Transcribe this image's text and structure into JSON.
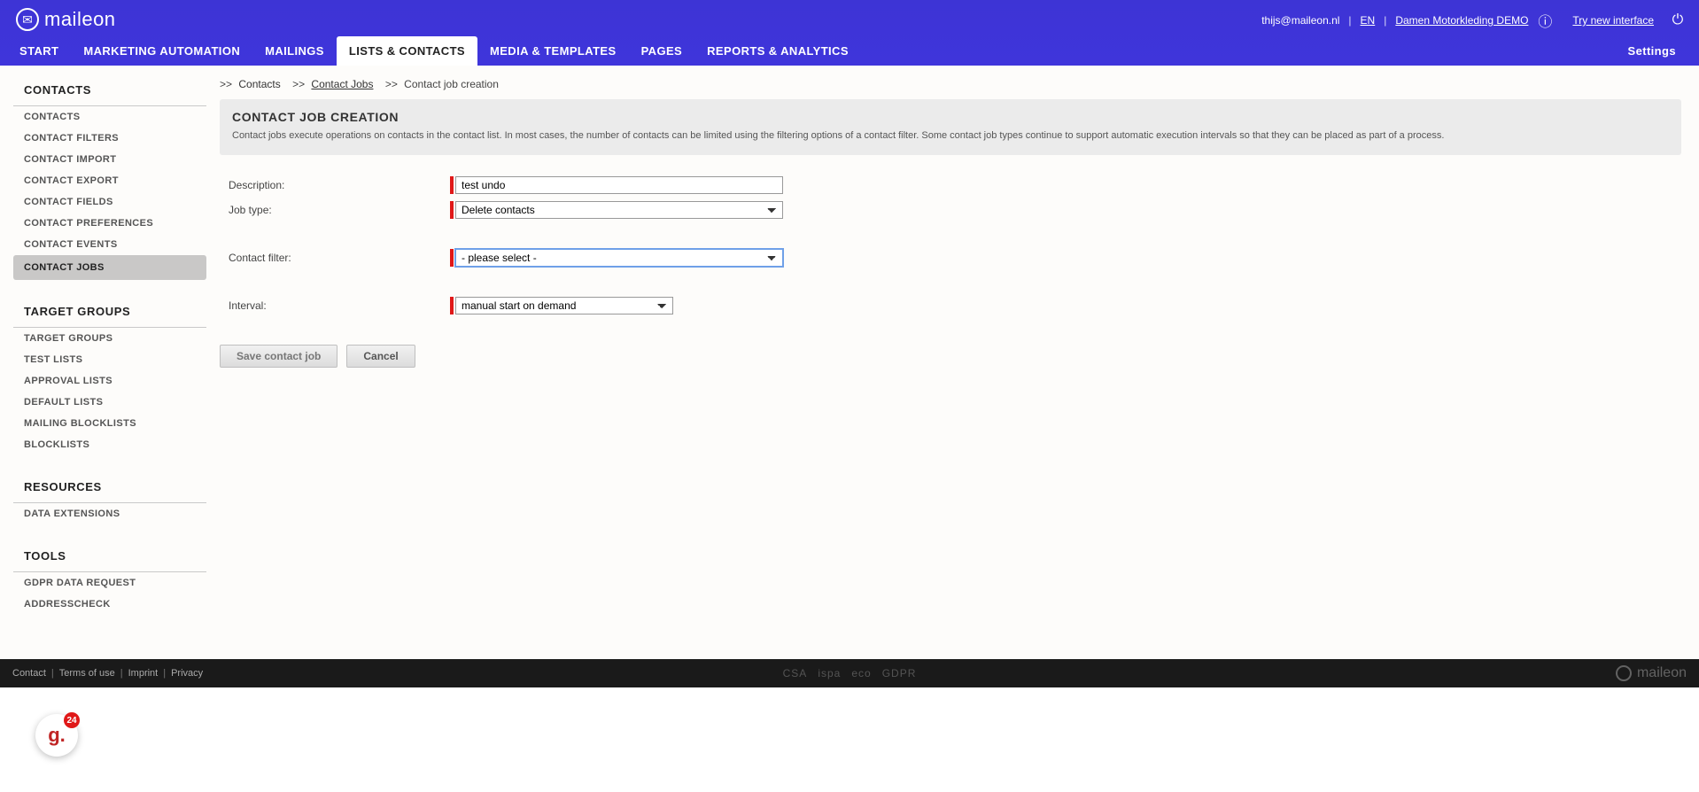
{
  "header": {
    "brand": "maileon",
    "user_email": "thijs@maileon.nl",
    "lang": "EN",
    "account": "Damen Motorkleding DEMO",
    "try_link": "Try new interface"
  },
  "nav": {
    "items": [
      "Start",
      "Marketing Automation",
      "Mailings",
      "Lists & Contacts",
      "Media & Templates",
      "Pages",
      "Reports & Analytics"
    ],
    "active_index": 3,
    "settings": "Settings"
  },
  "sidebar": [
    {
      "title": "Contacts",
      "items": [
        "Contacts",
        "Contact Filters",
        "Contact Import",
        "Contact Export",
        "Contact Fields",
        "Contact Preferences",
        "Contact Events",
        "Contact Jobs"
      ],
      "active_index": 7
    },
    {
      "title": "Target Groups",
      "items": [
        "Target Groups",
        "Test Lists",
        "Approval Lists",
        "Default Lists",
        "Mailing Blocklists",
        "Blocklists"
      ],
      "active_index": -1
    },
    {
      "title": "Resources",
      "items": [
        "Data Extensions"
      ],
      "active_index": -1
    },
    {
      "title": "Tools",
      "items": [
        "GDPR Data Request",
        "Addresscheck"
      ],
      "active_index": -1
    }
  ],
  "breadcrumb": {
    "sep": ">>",
    "parts": [
      "Contacts",
      "Contact Jobs",
      "Contact job creation"
    ]
  },
  "panel": {
    "title": "Contact Job Creation",
    "text": "Contact jobs execute operations on contacts in the contact list. In most cases, the number of contacts can be limited using the filtering options of a contact filter. Some contact job types continue to support automatic execution intervals so that they can be placed as part of a process."
  },
  "form": {
    "description": {
      "label": "Description:",
      "value": "test undo"
    },
    "job_type": {
      "label": "Job type:",
      "value": "Delete contacts"
    },
    "contact_filter": {
      "label": "Contact filter:",
      "value": "- please select -"
    },
    "interval": {
      "label": "Interval:",
      "value": "manual start on demand"
    }
  },
  "buttons": {
    "save": "Save contact job",
    "cancel": "Cancel"
  },
  "footer": {
    "links": [
      "Contact",
      "Terms of use",
      "Imprint",
      "Privacy"
    ],
    "badges": [
      "CSA",
      "ispa",
      "eco",
      "GDPR"
    ],
    "brand": "maileon"
  },
  "float_badge": {
    "glyph": "g.",
    "count": "24"
  }
}
